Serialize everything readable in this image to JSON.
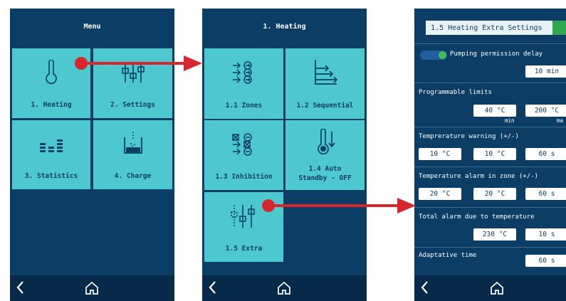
{
  "screen1": {
    "title": "Menu",
    "tiles": [
      {
        "label": "1. Heating",
        "icon": "thermometer-icon"
      },
      {
        "label": "2. Settings",
        "icon": "sliders-icon"
      },
      {
        "label": "3. Statistics",
        "icon": "bar-chart-icon"
      },
      {
        "label": "4. Charge",
        "icon": "charge-container-icon"
      }
    ]
  },
  "screen2": {
    "title": "1. Heating",
    "tiles": [
      {
        "label": "1.1 Zones",
        "icon": "zones-arrows-icon"
      },
      {
        "label": "1.2 Sequential",
        "icon": "sequential-icon"
      },
      {
        "label": "1.3 Inhibition",
        "icon": "inhibition-icon"
      },
      {
        "label_line1": "1.4 Auto",
        "label_line2": "Standby - OFF",
        "icon": "auto-standby-icon"
      },
      {
        "label": "1.5 Extra",
        "icon": "extra-settings-icon"
      }
    ]
  },
  "screen3": {
    "title": "1.5 Heating Extra Settings",
    "pumping": {
      "label": "Pumping permission delay",
      "value": "10 min",
      "enabled": true
    },
    "limits": {
      "label": "Programmable limits",
      "min_value": "40 °C",
      "max_value": "200 °C",
      "min_label": "min",
      "max_label": "ma"
    },
    "warning": {
      "label": "Temprerature warning  (+/-)",
      "v1": "10 °C",
      "v2": "10 °C",
      "v3": "60 s"
    },
    "alarm": {
      "label": "Temperature alarm in zone  (+/-)",
      "v1": "20 °C",
      "v2": "20 °C",
      "v3": "60 s"
    },
    "total": {
      "label": "Total alarm due to temperature",
      "v1": "230 °C",
      "v2": "10 s"
    },
    "adaptive": {
      "label": "Adaptative time",
      "value": "60 s"
    }
  },
  "colors": {
    "screen_bg": "#0c3e65",
    "tile": "#4ec8cf",
    "footer": "#07294a",
    "arrow": "#d8262e"
  }
}
